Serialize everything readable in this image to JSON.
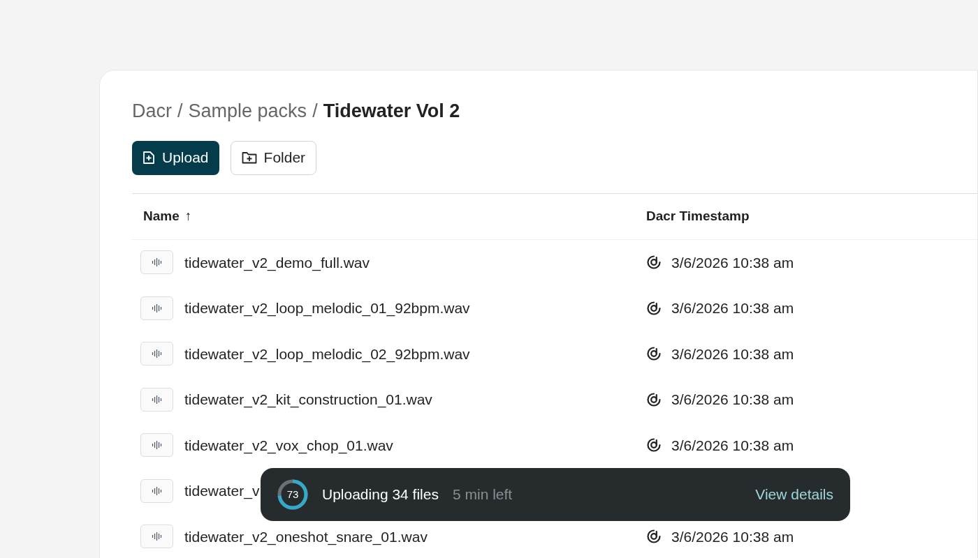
{
  "breadcrumb": [
    {
      "label": "Dacr",
      "current": false
    },
    {
      "label": "Sample packs",
      "current": false
    },
    {
      "label": "Tidewater Vol 2",
      "current": true
    }
  ],
  "separator": "/",
  "buttons": [
    {
      "label": "Upload",
      "kind": "primary"
    },
    {
      "label": "Folder",
      "kind": "secondary"
    }
  ],
  "table": {
    "columns": [
      {
        "label": "Name",
        "sort": "↑"
      },
      {
        "label": "Dacr Timestamp"
      }
    ],
    "rows": [
      {
        "name": "tidewater_v2_demo_full.wav",
        "timestamp": "3/6/2026 10:38 am"
      },
      {
        "name": "tidewater_v2_loop_melodic_01_92bpm.wav",
        "timestamp": "3/6/2026 10:38 am"
      },
      {
        "name": "tidewater_v2_loop_melodic_02_92bpm.wav",
        "timestamp": "3/6/2026 10:38 am"
      },
      {
        "name": "tidewater_v2_kit_construction_01.wav",
        "timestamp": "3/6/2026 10:38 am"
      },
      {
        "name": "tidewater_v2_vox_chop_01.wav",
        "timestamp": "3/6/2026 10:38 am"
      },
      {
        "name": "tidewater_v"
      },
      {
        "name": "tidewater_v2_oneshot_snare_01.wav",
        "timestamp": "3/6/2026 10:38 am"
      }
    ]
  },
  "upload_toast": {
    "percent": "73",
    "level": 0.73,
    "title": "Uploading 34 files",
    "eta": "5 min left",
    "action": "View details"
  }
}
